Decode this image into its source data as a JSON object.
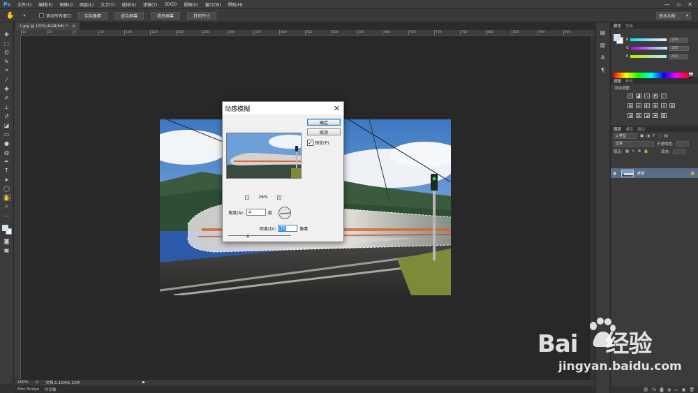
{
  "menubar": {
    "logo": "Ps",
    "items": [
      "文件(F)",
      "编辑(E)",
      "图像(I)",
      "图层(L)",
      "文字(Y)",
      "选择(S)",
      "滤镜(T)",
      "3D(D)",
      "视图(V)",
      "窗口(W)",
      "帮助(H)"
    ],
    "controls": [
      "—",
      "▫",
      "✕"
    ]
  },
  "optionsbar": {
    "scroll_all_label": "滚动所有窗口",
    "buttons": [
      "实际像素",
      "适合屏幕",
      "填充屏幕",
      "打印尺寸"
    ],
    "workspace": "基本功能"
  },
  "document": {
    "tab_title": "1.jpg @ 100%(RGB/8#) *",
    "tab_close": "×"
  },
  "ruler": {
    "ticks": [
      "10",
      "50",
      "0",
      "50",
      "100",
      "150",
      "200",
      "250",
      "300",
      "350",
      "400",
      "450",
      "500",
      "550",
      "600",
      "650",
      "700",
      "750",
      "800",
      "850",
      "900",
      "950"
    ]
  },
  "statusbar": {
    "zoom": "100%",
    "doc_info": "文档:1.11M/1.11M",
    "arrow": "▶"
  },
  "bridge": {
    "tabs": [
      "Mini Bridge",
      "时间轴"
    ]
  },
  "panels": {
    "color_tabs": [
      "颜色",
      "色板"
    ],
    "sliders": [
      {
        "label": "R",
        "value": "184",
        "color": "#e06666"
      },
      {
        "label": "G",
        "value": "230",
        "color": "#66cc66"
      },
      {
        "label": "B",
        "value": "248",
        "color": "#6699ee"
      }
    ],
    "adjust_tabs": [
      "调整",
      "样式"
    ],
    "adjust_label": "添加调整",
    "layers_tabs": [
      "图层",
      "通道",
      "路径"
    ],
    "kind_select": "ρ 类型",
    "blend_mode": "正常",
    "opacity_label": "不透明度:",
    "lock_label": "锁定:",
    "fill_label": "填充:",
    "layer_name": "背景"
  },
  "dialog": {
    "title": "动感模糊",
    "ok": "确定",
    "cancel": "取消",
    "preview_label": "预览(P)",
    "zoom": "26%",
    "zoom_minus": "−",
    "zoom_plus": "+",
    "angle_label": "角度(A):",
    "angle_value": "4",
    "angle_unit": "度",
    "distance_label": "距离(D):",
    "distance_value": "75",
    "distance_unit": "像素"
  },
  "watermark": {
    "brand_left": "Bai",
    "brand_right": "经验",
    "url": "jingyan.baidu.com"
  }
}
